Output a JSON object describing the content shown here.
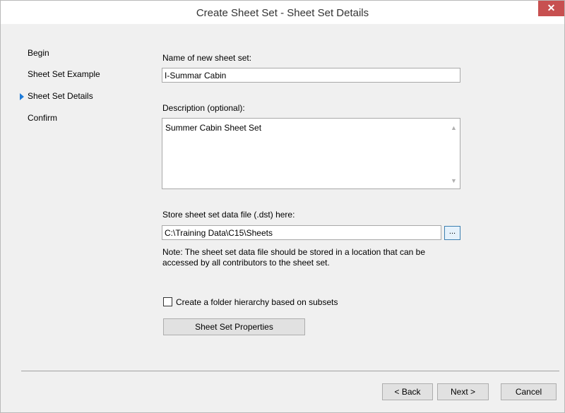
{
  "window": {
    "title": "Create Sheet Set - Sheet Set Details",
    "close_symbol": "✕"
  },
  "sidebar": {
    "items": [
      {
        "label": "Begin"
      },
      {
        "label": "Sheet Set Example"
      },
      {
        "label": "Sheet Set Details",
        "current": true
      },
      {
        "label": "Confirm"
      }
    ]
  },
  "form": {
    "name_label": "Name of new sheet set:",
    "name_value": "I-Summar Cabin",
    "description_label": "Description (optional):",
    "description_value": "Summer Cabin Sheet Set",
    "store_label": "Store sheet set data file (.dst) here:",
    "store_value": "C:\\Training Data\\C15\\Sheets",
    "browse_label": "...",
    "note": "Note: The sheet set data file should be stored in a location that can be accessed by all contributors to the sheet set.",
    "folder_hierarchy_label": "Create a folder hierarchy based on subsets",
    "folder_hierarchy_checked": false,
    "properties_button": "Sheet Set Properties"
  },
  "footer": {
    "back": "< Back",
    "next": "Next >",
    "cancel": "Cancel"
  },
  "colors": {
    "close_button": "#c75050",
    "current_step_arrow": "#1e7bd9",
    "default_button_border": "#3c7fb1"
  }
}
